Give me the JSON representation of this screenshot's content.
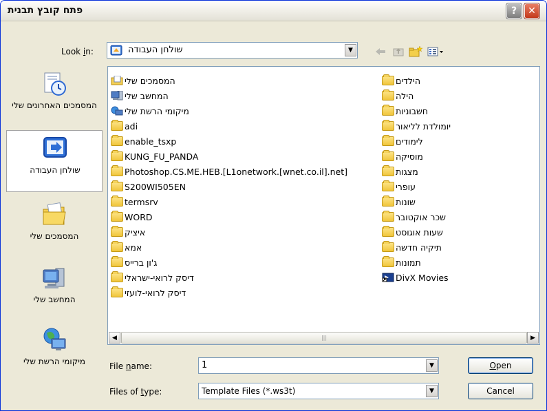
{
  "window": {
    "title": "פתח קובץ תבנית",
    "help_glyph": "?",
    "close_glyph": "✕"
  },
  "look_in": {
    "label": "Look in:",
    "label_mnemonic": "i",
    "value": "שולחן העבודה"
  },
  "places": [
    {
      "label": "המסמכים האחרונים שלי",
      "icon": "recent-documents-icon",
      "selected": false
    },
    {
      "label": "שולחן העבודה",
      "icon": "desktop-icon",
      "selected": true
    },
    {
      "label": "המסמכים שלי",
      "icon": "my-documents-icon",
      "selected": false
    },
    {
      "label": "המחשב שלי",
      "icon": "my-computer-icon",
      "selected": false
    },
    {
      "label": "מיקומי הרשת שלי",
      "icon": "network-places-icon",
      "selected": false
    }
  ],
  "file_list": {
    "column_left": [
      {
        "name": "המסמכים שלי",
        "icon": "my-documents-icon",
        "rtl": true
      },
      {
        "name": "המחשב שלי",
        "icon": "my-computer-icon",
        "rtl": true
      },
      {
        "name": "מיקומי הרשת שלי",
        "icon": "network-places-icon",
        "rtl": true
      },
      {
        "name": "adi",
        "icon": "folder-icon",
        "rtl": false
      },
      {
        "name": "enable_tsxp",
        "icon": "folder-icon",
        "rtl": false
      },
      {
        "name": "KUNG_FU_PANDA",
        "icon": "folder-icon",
        "rtl": false
      },
      {
        "name": "Photoshop.CS.ME.HEB.[L1onetwork.[wnet.co.il].net]",
        "icon": "folder-icon",
        "rtl": false
      },
      {
        "name": "S200WI505EN",
        "icon": "folder-icon",
        "rtl": false
      },
      {
        "name": "termsrv",
        "icon": "folder-icon",
        "rtl": false
      },
      {
        "name": "WORD",
        "icon": "folder-icon",
        "rtl": false
      },
      {
        "name": "איציק",
        "icon": "folder-icon",
        "rtl": true
      },
      {
        "name": "אמא",
        "icon": "folder-icon",
        "rtl": true
      },
      {
        "name": "ג'ון ברייס",
        "icon": "folder-icon",
        "rtl": true
      },
      {
        "name": "דיסק לרואי-ישראלי",
        "icon": "folder-icon",
        "rtl": true
      },
      {
        "name": "דיסק לרואי-לועזי",
        "icon": "folder-icon",
        "rtl": true
      }
    ],
    "column_right": [
      {
        "name": "הילדים",
        "icon": "folder-icon",
        "rtl": true
      },
      {
        "name": "הילה",
        "icon": "folder-icon",
        "rtl": true
      },
      {
        "name": "חשבוניות",
        "icon": "folder-icon",
        "rtl": true
      },
      {
        "name": "יומולדת לליאור",
        "icon": "folder-icon",
        "rtl": true
      },
      {
        "name": "לימודים",
        "icon": "folder-icon",
        "rtl": true
      },
      {
        "name": "מוסיקה",
        "icon": "folder-icon",
        "rtl": true
      },
      {
        "name": "מצגות",
        "icon": "folder-icon",
        "rtl": true
      },
      {
        "name": "עופרי",
        "icon": "folder-icon",
        "rtl": true
      },
      {
        "name": "שונות",
        "icon": "folder-icon",
        "rtl": true
      },
      {
        "name": "שכר אוקטובר",
        "icon": "folder-icon",
        "rtl": true
      },
      {
        "name": "שעות אוגוסט",
        "icon": "folder-icon",
        "rtl": true
      },
      {
        "name": "תיקיה חדשה",
        "icon": "folder-icon",
        "rtl": true
      },
      {
        "name": "תמונות",
        "icon": "folder-icon",
        "rtl": true
      },
      {
        "name": "DivX Movies",
        "icon": "divx-shortcut-icon",
        "rtl": false
      }
    ],
    "scroll_left_glyph": "◀",
    "scroll_right_glyph": "▶",
    "thumb_grip": "|||"
  },
  "file_name": {
    "label": "File name:",
    "value": "1"
  },
  "file_type": {
    "label": "Files of type:",
    "value": "Template Files (*.ws3t)"
  },
  "buttons": {
    "open": "Open",
    "cancel": "Cancel"
  },
  "combo_arrow_glyph": "▼"
}
